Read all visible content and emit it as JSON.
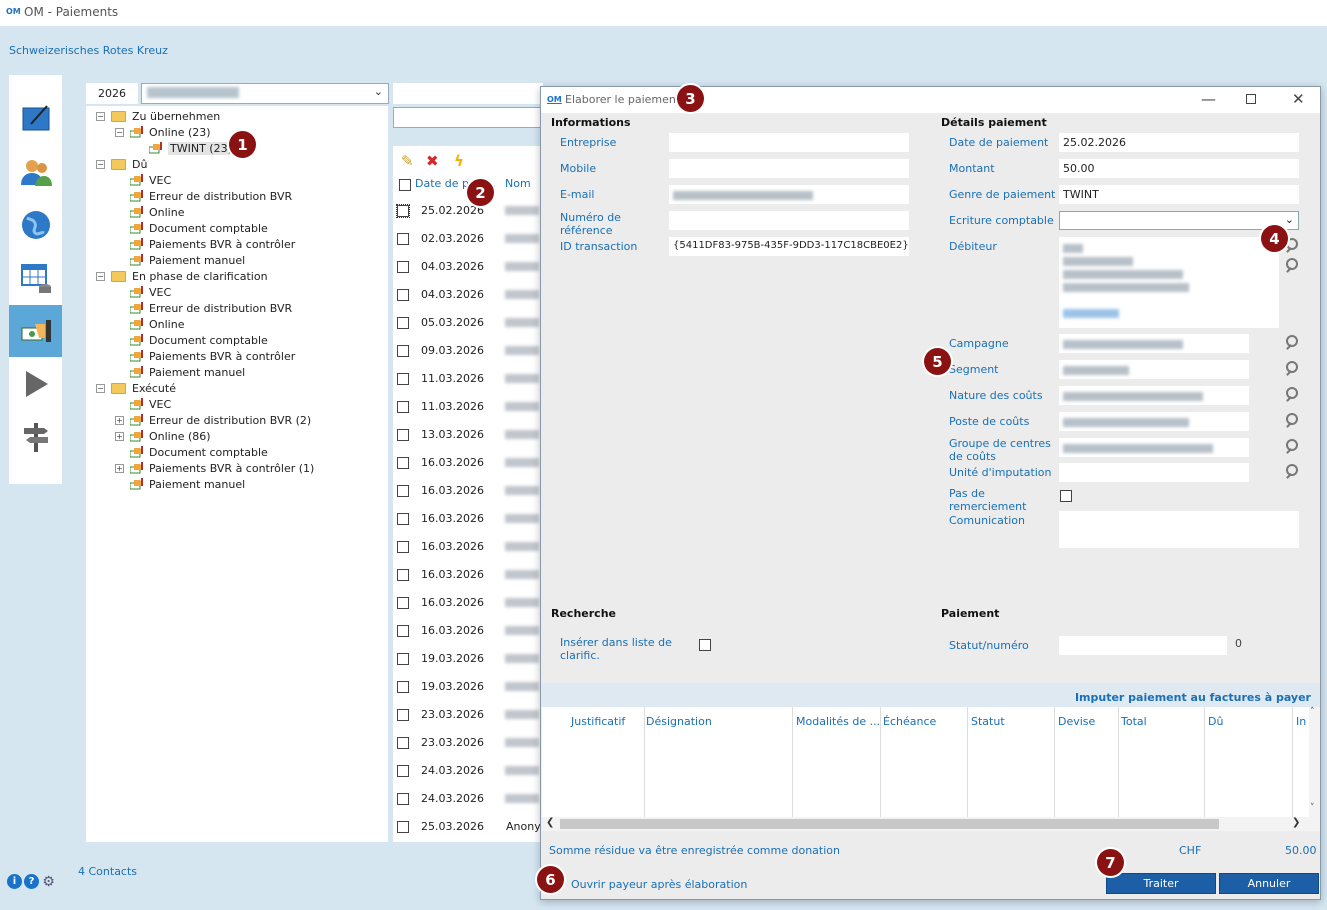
{
  "app": {
    "logo": "OM",
    "title": "OM - Paiements",
    "organization": "Schweizerisches Rotes Kreuz"
  },
  "nav": {
    "items": [
      "edit-icon",
      "contacts-icon",
      "globe-icon",
      "table-icon",
      "payments-icon",
      "play-icon",
      "signpost-icon"
    ],
    "active": "payments-icon"
  },
  "footer": {
    "contacts": "4 Contacts",
    "info": "i",
    "help": "?"
  },
  "filter": {
    "year": "2026"
  },
  "tree": [
    {
      "label": "Zu übernehmen",
      "level": 0,
      "type": "folder",
      "toggle": "−"
    },
    {
      "label": "Online (23)",
      "level": 1,
      "type": "pay",
      "toggle": "−"
    },
    {
      "label": "TWINT (23)",
      "level": 2,
      "type": "pay",
      "toggle": "",
      "selected": true
    },
    {
      "label": "Dû",
      "level": 0,
      "type": "folder",
      "toggle": "−"
    },
    {
      "label": "VEC",
      "level": 1,
      "type": "pay",
      "toggle": ""
    },
    {
      "label": "Erreur de distribution BVR",
      "level": 1,
      "type": "pay",
      "toggle": ""
    },
    {
      "label": "Online",
      "level": 1,
      "type": "pay",
      "toggle": ""
    },
    {
      "label": "Document comptable",
      "level": 1,
      "type": "pay",
      "toggle": ""
    },
    {
      "label": "Paiements BVR à contrôler",
      "level": 1,
      "type": "pay",
      "toggle": ""
    },
    {
      "label": "Paiement manuel",
      "level": 1,
      "type": "pay",
      "toggle": ""
    },
    {
      "label": "En phase de clarification",
      "level": 0,
      "type": "folder",
      "toggle": "−"
    },
    {
      "label": "VEC",
      "level": 1,
      "type": "pay",
      "toggle": ""
    },
    {
      "label": "Erreur de distribution BVR",
      "level": 1,
      "type": "pay",
      "toggle": ""
    },
    {
      "label": "Online",
      "level": 1,
      "type": "pay",
      "toggle": ""
    },
    {
      "label": "Document comptable",
      "level": 1,
      "type": "pay",
      "toggle": ""
    },
    {
      "label": "Paiements BVR à contrôler",
      "level": 1,
      "type": "pay",
      "toggle": ""
    },
    {
      "label": "Paiement manuel",
      "level": 1,
      "type": "pay",
      "toggle": ""
    },
    {
      "label": "Exécuté",
      "level": 0,
      "type": "folder",
      "toggle": "−"
    },
    {
      "label": "VEC",
      "level": 1,
      "type": "pay",
      "toggle": ""
    },
    {
      "label": "Erreur de distribution BVR (2)",
      "level": 1,
      "type": "pay",
      "toggle": "+"
    },
    {
      "label": "Online (86)",
      "level": 1,
      "type": "pay",
      "toggle": "+"
    },
    {
      "label": "Document comptable",
      "level": 1,
      "type": "pay",
      "toggle": ""
    },
    {
      "label": "Paiements BVR à contrôler (1)",
      "level": 1,
      "type": "pay",
      "toggle": "+"
    },
    {
      "label": "Paiement manuel",
      "level": 1,
      "type": "pay",
      "toggle": ""
    }
  ],
  "list": {
    "columns": {
      "date": "Date de paie...",
      "name": "Nom"
    },
    "rows": [
      {
        "date": "25.02.2026",
        "name": ""
      },
      {
        "date": "02.03.2026",
        "name": ""
      },
      {
        "date": "04.03.2026",
        "name": ""
      },
      {
        "date": "04.03.2026",
        "name": ""
      },
      {
        "date": "05.03.2026",
        "name": ""
      },
      {
        "date": "09.03.2026",
        "name": ""
      },
      {
        "date": "11.03.2026",
        "name": ""
      },
      {
        "date": "11.03.2026",
        "name": ""
      },
      {
        "date": "13.03.2026",
        "name": ""
      },
      {
        "date": "16.03.2026",
        "name": ""
      },
      {
        "date": "16.03.2026",
        "name": ""
      },
      {
        "date": "16.03.2026",
        "name": ""
      },
      {
        "date": "16.03.2026",
        "name": ""
      },
      {
        "date": "16.03.2026",
        "name": ""
      },
      {
        "date": "16.03.2026",
        "name": ""
      },
      {
        "date": "16.03.2026",
        "name": ""
      },
      {
        "date": "19.03.2026",
        "name": ""
      },
      {
        "date": "19.03.2026",
        "name": ""
      },
      {
        "date": "23.03.2026",
        "name": ""
      },
      {
        "date": "23.03.2026",
        "name": ""
      },
      {
        "date": "24.03.2026",
        "name": ""
      },
      {
        "date": "24.03.2026",
        "name": ""
      },
      {
        "date": "25.03.2026",
        "name": "Anony"
      }
    ]
  },
  "dialog": {
    "logo": "OM",
    "title": "Elaborer le paiement",
    "info": {
      "heading": "Informations",
      "entreprise": "Entreprise",
      "mobile": "Mobile",
      "email": "E-mail",
      "reference": "Numéro de référence",
      "transaction_label": "ID transaction",
      "transaction_value": "{5411DF83-975B-435F-9DD3-117C18CBE0E2}"
    },
    "details": {
      "heading": "Détails paiement",
      "date_label": "Date de paiement",
      "date_value": "25.02.2026",
      "montant_label": "Montant",
      "montant_value": "50.00",
      "genre_label": "Genre de paiement",
      "genre_value": "TWINT",
      "ecriture_label": "Ecriture comptable",
      "debiteur_label": "Débiteur",
      "campagne_label": "Campagne",
      "segment_label": "Segment",
      "nature_label": "Nature des coûts",
      "poste_label": "Poste de coûts",
      "groupe_label": "Groupe de centres de coûts",
      "unite_label": "Unité d'imputation",
      "pas_label": "Pas de remerciement",
      "comm_label": "Comunication"
    },
    "recherche": {
      "heading": "Recherche",
      "inserer_label": "Insérer dans liste de clarific."
    },
    "paiement": {
      "heading": "Paiement",
      "statut_label": "Statut/numéro",
      "statut_value": "0"
    },
    "grid": {
      "link": "Imputer paiement au factures à payer",
      "columns": [
        "Justificatif",
        "Désignation",
        "Modalités de ...",
        "Échéance",
        "Statut",
        "Devise",
        "Total",
        "Dû",
        "In"
      ]
    },
    "footer": {
      "residue": "Somme résidue va être enregistrée comme donation",
      "currency": "CHF",
      "amount": "50.00",
      "ouvrir": "Ouvrir payeur après élaboration",
      "traiter": "Traiter",
      "annuler": "Annuler"
    }
  },
  "annotations": [
    "1",
    "2",
    "3",
    "4",
    "5",
    "6",
    "7"
  ]
}
